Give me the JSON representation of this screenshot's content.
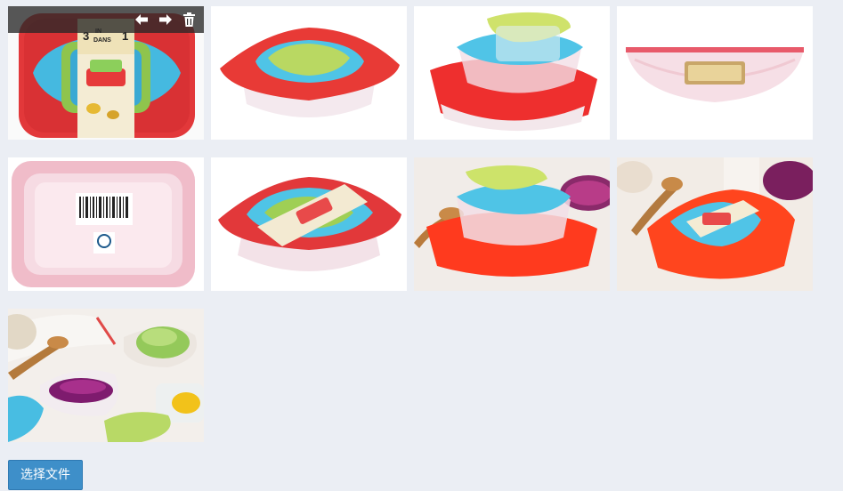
{
  "gallery": {
    "images": [
      {
        "name": "product-photo-1"
      },
      {
        "name": "product-photo-2"
      },
      {
        "name": "product-photo-3"
      },
      {
        "name": "product-photo-4"
      },
      {
        "name": "product-photo-5"
      },
      {
        "name": "product-photo-6"
      },
      {
        "name": "product-photo-7"
      },
      {
        "name": "product-photo-8"
      },
      {
        "name": "product-photo-9"
      }
    ],
    "overlay_icons": [
      "arrow-left-icon",
      "arrow-right-icon",
      "trash-icon"
    ]
  },
  "package_label": {
    "count": "3",
    "word_in": "IN",
    "word_dans": "DANS",
    "count_right": "1"
  },
  "upload": {
    "button_label": "选择文件"
  },
  "colors": {
    "page_bg": "#ebeef4",
    "button_bg": "#3e8fc9",
    "red_lid": "#e83a36",
    "blue_lid": "#4fc4e6",
    "green_lid": "#b9d862",
    "overlay_bg": "#282828"
  }
}
